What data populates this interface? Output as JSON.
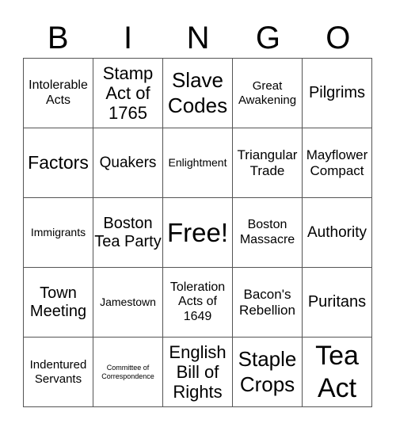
{
  "header": {
    "letters": [
      "B",
      "I",
      "N",
      "G",
      "O"
    ]
  },
  "cells": [
    "Intolerable Acts",
    "Stamp Act of 1765",
    "Slave Codes",
    "Great Awakening",
    "Pilgrims",
    "Factors",
    "Quakers",
    "Enlightment",
    "Triangular Trade",
    "Mayflower Compact",
    "Immigrants",
    "Boston Tea Party",
    "Free!",
    "Boston Massacre",
    "Authority",
    "Town Meeting",
    "Jamestown",
    "Toleration Acts of 1649",
    "Bacon's Rebellion",
    "Puritans",
    "Indentured Servants",
    "Committee of Correspondence",
    "English Bill of Rights",
    "Staple Crops",
    "Tea Act"
  ]
}
